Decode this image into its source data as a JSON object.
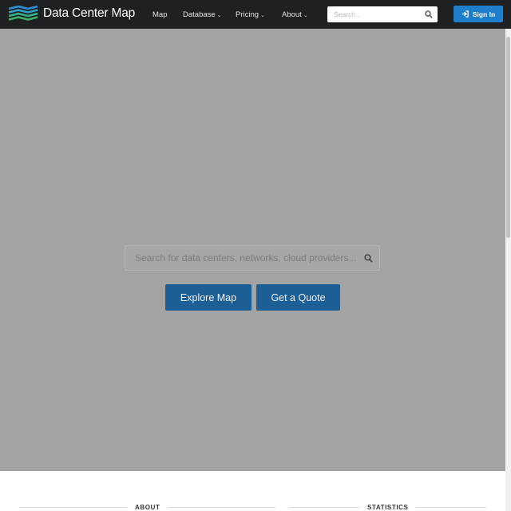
{
  "header": {
    "brand": "Data Center Map",
    "nav": [
      {
        "label": "Map",
        "dropdown": false
      },
      {
        "label": "Database",
        "dropdown": true
      },
      {
        "label": "Pricing",
        "dropdown": true
      },
      {
        "label": "About",
        "dropdown": true
      }
    ],
    "search_placeholder": "Search...",
    "signin_label": "Sign In",
    "colors": {
      "bar": "#1e2022",
      "signin": "#1f7ecb",
      "logo_green": "#3ab56a",
      "logo_blue": "#2f8fd8"
    }
  },
  "hero": {
    "search_placeholder": "Search for data centers, networks, cloud providers...",
    "explore_label": "Explore Map",
    "quote_label": "Get a Quote",
    "colors": {
      "overlay": "#a3a3a3",
      "button": "#1b5f96"
    }
  },
  "footer": {
    "about_heading": "ABOUT",
    "statistics_heading": "STATISTICS"
  }
}
